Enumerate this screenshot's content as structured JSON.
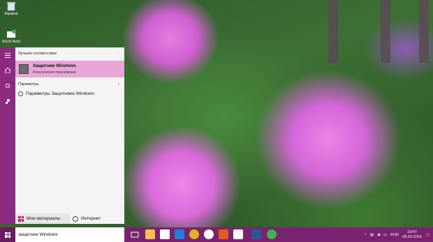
{
  "desktop": {
    "icons": [
      {
        "label": "Корзина",
        "icon": "recycle-bin-icon"
      },
      {
        "label": "ASUS NetU",
        "icon": "asus-app-icon"
      }
    ]
  },
  "start_menu": {
    "rail_icons": [
      "hamburger-menu-icon",
      "home-icon",
      "settings-icon",
      "user-icon"
    ],
    "best_match_header": "Лучшее соответствие",
    "more_label": "···",
    "best_match": {
      "title": "Защитник Windows",
      "subtitle": "Классическое приложение",
      "icon": "windows-defender-icon"
    },
    "settings_header": "Параметры",
    "settings_chevron": "›",
    "settings_items": [
      {
        "label": "Параметры Защитника Windows",
        "icon": "gear-icon"
      }
    ],
    "tabs": {
      "my_stuff": "Мои материалы",
      "web": "Интернет"
    }
  },
  "taskbar": {
    "search_value": "защитник Windows",
    "apps": [
      {
        "name": "task-view-icon",
        "color": "#ffffff"
      },
      {
        "name": "file-explorer-icon",
        "color": "#f2c14e"
      },
      {
        "name": "store-icon",
        "color": "#ffffff"
      },
      {
        "name": "edge-icon",
        "color": "#1e7fd6"
      },
      {
        "name": "chrome-icon",
        "color": "#e0b21d"
      },
      {
        "name": "yandex-browser-icon",
        "color": "#ffffff"
      },
      {
        "name": "media-player-icon",
        "color": "#e85a1b"
      },
      {
        "name": "onedrive-icon",
        "color": "#ffffff"
      },
      {
        "name": "word-icon",
        "color": "#2b5797"
      },
      {
        "name": "greenshot-icon",
        "color": "#3bb54a"
      }
    ],
    "tray": {
      "language": "ENG",
      "time": "10:47",
      "date": "05.02.2016"
    }
  },
  "colors": {
    "accent": "#8c2a7f",
    "best_match_highlight": "#e8a6d6"
  }
}
